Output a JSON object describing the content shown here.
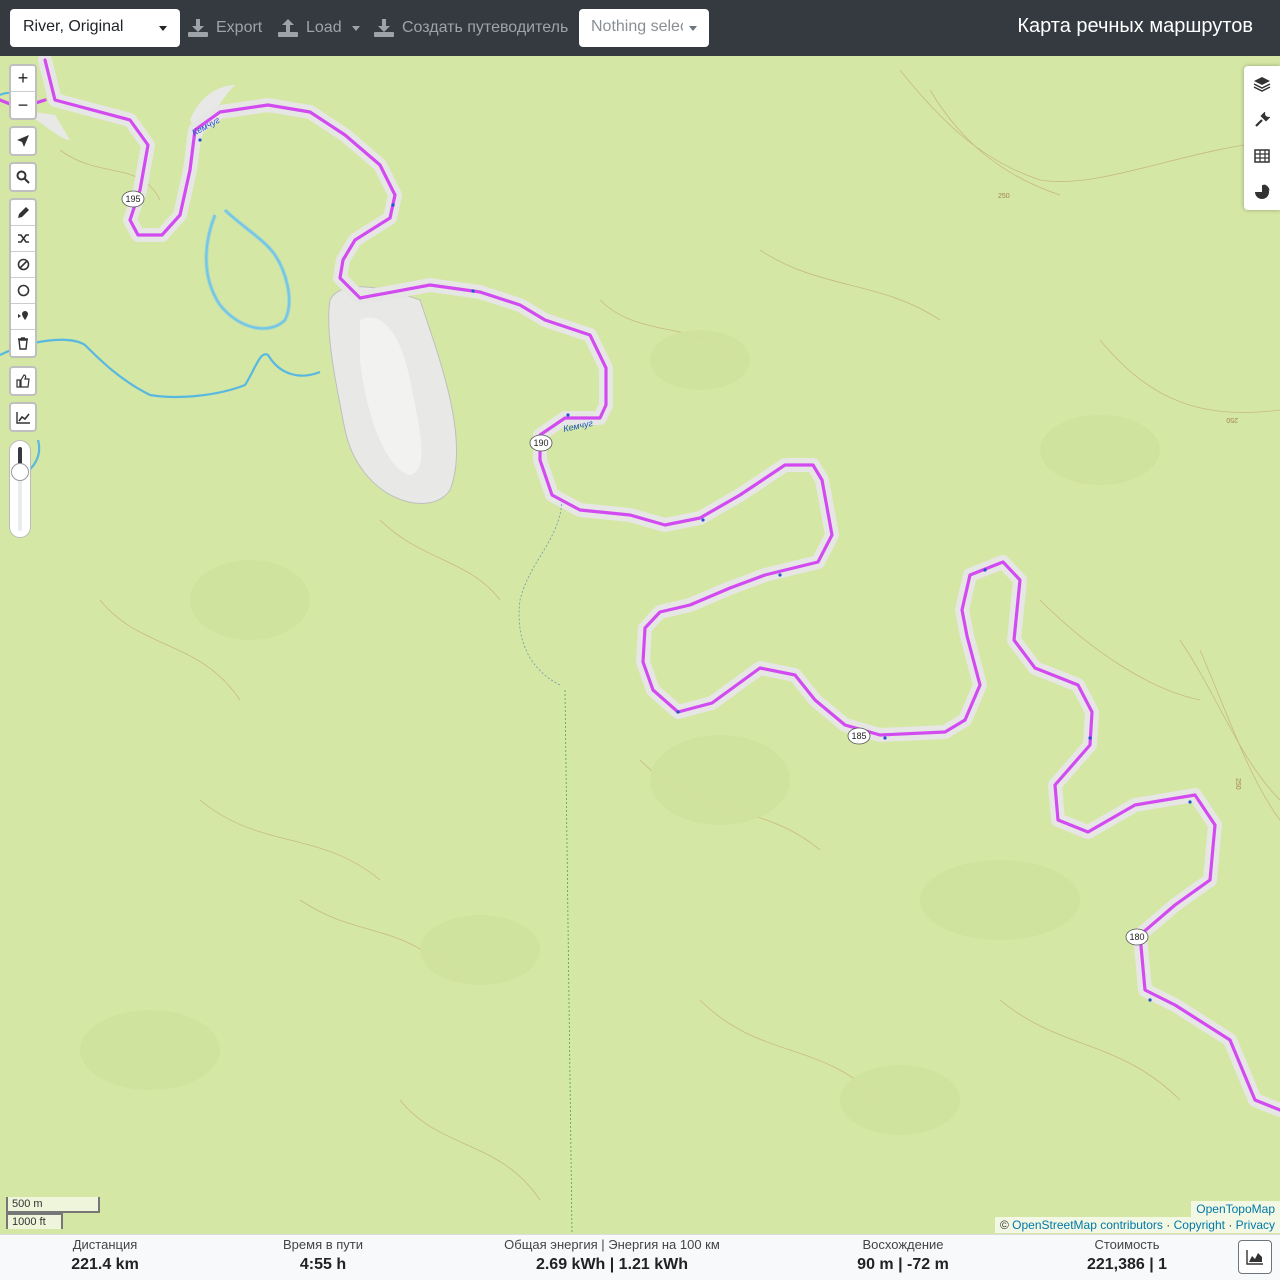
{
  "topbar": {
    "profile": "River, Original",
    "export_label": "Export",
    "load_label": "Load",
    "guide_label": "Создать путеводитель",
    "route_select": "Nothing selec",
    "title": "Карта речных маршрутов"
  },
  "map": {
    "zoom_in": "+",
    "zoom_out": "−",
    "river_name_1": "Кемчуг",
    "river_name_2": "Кемчуг",
    "km_markers": [
      "195",
      "190",
      "185",
      "180"
    ],
    "contour_labels": [
      "250",
      "250",
      "250"
    ],
    "scale_metric": "500 m",
    "scale_imperial": "1000 ft",
    "attribution_provider": "OpenTopoMap",
    "attribution_copy": "©",
    "attribution_osm": "OpenStreetMap contributors",
    "attribution_sep1": "·",
    "attribution_copyright": "Copyright",
    "attribution_sep2": "·",
    "attribution_privacy": "Privacy",
    "route_color": "#d24bf0",
    "water_color": "#59b8e0"
  },
  "stats": {
    "distance_label": "Дистанция",
    "distance_value": "221.4 km",
    "time_label": "Время в пути",
    "time_value": "4:55 h",
    "energy_label": "Общая энергия | Энергия на 100 км",
    "energy_value": "2.69 kWh | 1.21 kWh",
    "ascent_label": "Восхождение",
    "ascent_value": "90 m | -72 m",
    "cost_label": "Стоимость",
    "cost_value": "221,386 | 1"
  }
}
